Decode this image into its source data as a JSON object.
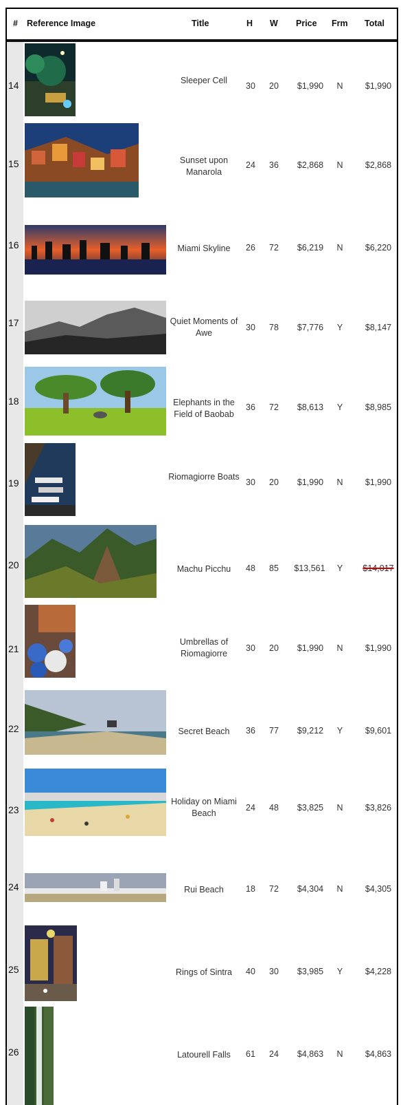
{
  "header": {
    "num": "#",
    "image": "Reference Image",
    "title": "Title",
    "h": "H",
    "w": "W",
    "price": "Price",
    "frm": "Frm",
    "total": "Total"
  },
  "rows": [
    {
      "num": "14",
      "title": "Sleeper Cell",
      "h": "30",
      "w": "20",
      "price": "$1,990",
      "frm": "N",
      "total": "$1,990",
      "image": "tropical-night-cafe"
    },
    {
      "num": "15",
      "title": "Sunset upon Manarola",
      "h": "24",
      "w": "36",
      "price": "$2,868",
      "frm": "N",
      "total": "$2,868",
      "image": "cliffside-village"
    },
    {
      "num": "16",
      "title": "Miami Skyline",
      "h": "26",
      "w": "72",
      "price": "$6,219",
      "frm": "N",
      "total": "$6,220",
      "image": "city-skyline-sunset"
    },
    {
      "num": "17",
      "title": "Quiet Moments of Awe",
      "h": "30",
      "w": "78",
      "price": "$7,776",
      "frm": "Y",
      "total": "$8,147",
      "image": "black-white-cliffs"
    },
    {
      "num": "18",
      "title": "Elephants in the Field of Baobab",
      "h": "36",
      "w": "72",
      "price": "$8,613",
      "frm": "Y",
      "total": "$8,985",
      "image": "savanna-trees"
    },
    {
      "num": "19",
      "title": "Riomagiorre Boats",
      "h": "30",
      "w": "20",
      "price": "$1,990",
      "frm": "N",
      "total": "$1,990",
      "image": "harbor-boats"
    },
    {
      "num": "20",
      "title": "Machu Picchu",
      "h": "48",
      "w": "85",
      "price": "$13,561",
      "frm": "Y",
      "total": "$14,017",
      "image": "mountain-ruins",
      "total_struck": true
    },
    {
      "num": "21",
      "title": "Umbrellas of Riomagiorre",
      "h": "30",
      "w": "20",
      "price": "$1,990",
      "frm": "N",
      "total": "$1,990",
      "image": "beach-umbrellas"
    },
    {
      "num": "22",
      "title": "Secret Beach",
      "h": "36",
      "w": "77",
      "price": "$9,212",
      "frm": "Y",
      "total": "$9,601",
      "image": "coastal-beach"
    },
    {
      "num": "23",
      "title": "Holiday on Miami Beach",
      "h": "24",
      "w": "48",
      "price": "$3,825",
      "frm": "N",
      "total": "$3,826",
      "image": "busy-beach"
    },
    {
      "num": "24",
      "title": "Rui Beach",
      "h": "18",
      "w": "72",
      "price": "$4,304",
      "frm": "N",
      "total": "$4,305",
      "image": "beach-panorama"
    },
    {
      "num": "25",
      "title": "Rings of Sintra",
      "h": "40",
      "w": "30",
      "price": "$3,985",
      "frm": "Y",
      "total": "$4,228",
      "image": "palace-street-night"
    },
    {
      "num": "26",
      "title": "Latourell Falls",
      "h": "61",
      "w": "24",
      "price": "$4,863",
      "frm": "N",
      "total": "$4,863",
      "image": "tall-waterfall"
    }
  ],
  "colors": {
    "header_rule": "#111111",
    "index_column": "#e8e8e8",
    "strike": "#d00000"
  }
}
